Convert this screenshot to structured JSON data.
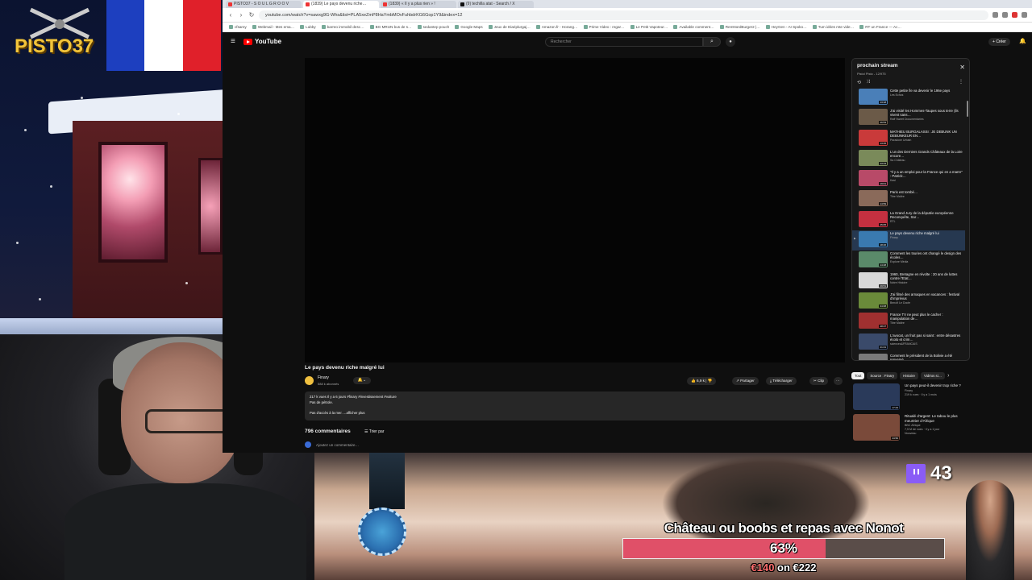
{
  "overlay": {
    "logo_text": "PISTO37",
    "flag_colors": [
      "#1d3fbf",
      "#ffffff",
      "#e0202a"
    ],
    "viewers": "43",
    "goal": {
      "title": "Château ou boobs et repas avec Nonot",
      "percent_label": "63%",
      "percent_value": 0.63,
      "current": "€140",
      "connector": " on ",
      "target": "€222",
      "fill_color": "#e05068"
    }
  },
  "browser": {
    "tabs": [
      {
        "label": "PISTO37 - S O U L G R O O V"
      },
      {
        "label": "(1839) Le pays devenu riche…"
      },
      {
        "label": "(1839) « Il y a plus rien » !"
      },
      {
        "label": "(9) techilla atat - Search / X"
      }
    ],
    "url": "youtube.com/watch?v=sawxg9G-Whs&list=PLA5xeZmP8HaYmbMOvFuhbdrKG6Gop1Y9&index=12",
    "bookmarks": [
      "cfsarey",
      "Webmail - Mes ema…",
      "Lubby",
      "barreo immobil desc…",
      "BG MRUN bus de s…",
      "sedantep pouch",
      "Google Maps",
      "Jeux de Diariplurgaj…",
      "Amazon.fr - Horang…",
      "Prime Video : regar…",
      "Le Petit Vapoteur…",
      "Available comment…",
      "RemNordBurger2 |…",
      "HeyGen - AI Spoko…",
      "Tum idées mte vide…",
      "RT un France — Ac…"
    ]
  },
  "youtube": {
    "logo": "YouTube",
    "search_placeholder": "Rechercher",
    "create_label": "Créer",
    "video": {
      "title": "Le pays devenu riche malgré lui",
      "channel": "Finary",
      "subs": "588 k abonnés",
      "likes": "6,9 k",
      "actions": [
        "Partager",
        "Télécharger",
        "Clip"
      ],
      "desc_meta": "217 k vues  Il y a 6 jours  #finary #investissement #voiture",
      "desc_l2": "Pas de pétrole.",
      "desc_l3": "Pas d'accès à la mer. ...afficher plus",
      "comments_count": "796 commentaires",
      "sort_label": "Trier par",
      "add_comment": "Ajoutez un commentaire…"
    },
    "playlist": {
      "title": "prochain stream",
      "subtitle": "Pistol Pisto - 12/975",
      "items": [
        {
          "title": "Cette petite île va devenir le 196e pays",
          "channel": "Les Echos",
          "duration": "13:18",
          "color": "#4a7fb8"
        },
        {
          "title": "J'ai visité les Hommes-Taupes sous terre (ils vivent sans…",
          "channel": "Raff Sweet Documentaries",
          "duration": "26:53",
          "color": "#6b5a48"
        },
        {
          "title": "MATHIEU BURGALASSI : JE DEBUNK UN DEBUNKEUR EN…",
          "channel": "Paradoxe Urbain",
          "duration": "13:25",
          "color": "#c93a3a"
        },
        {
          "title": "L'un des Derniers Grands Châteaux de la Loire encore…",
          "channel": "Sa Château",
          "duration": "43:23",
          "color": "#7a8a5a"
        },
        {
          "title": "\"Il y a un emploi pour la France qui en a marre\" : Patrick…",
          "channel": "Kasl",
          "duration": "19:01",
          "color": "#b84a68"
        },
        {
          "title": "Paris est tombé…",
          "channel": "Titre Maître",
          "duration": "14:59",
          "color": "#8a6a5a"
        },
        {
          "title": "La Grand Jury de la députée européenne Reconquête, Sar…",
          "channel": "RTL",
          "duration": "45:05",
          "color": "#c43040"
        },
        {
          "title": "Le pays devenu riche malgré lui",
          "channel": "Finary",
          "duration": "18:26",
          "color": "#3a7ab0",
          "current": true
        },
        {
          "title": "Comment les tsuries ont changé le design des écoles…",
          "channel": "Explore Média",
          "duration": "14:48",
          "color": "#5a8a6a"
        },
        {
          "title": "1960, Bretagne en révolte : 20 ans de luttes contre l'Etat…",
          "channel": "Notre Histoire",
          "duration": "49:51",
          "color": "#d8d8d8"
        },
        {
          "title": "J'ai filmé des arnaques en vacances : festival d'imprévus",
          "channel": "Benoît Le Docte",
          "duration": "34:08",
          "color": "#6a8a3a"
        },
        {
          "title": "France TV ne peut plus le cacher : manipulation de…",
          "channel": "Titre Maître",
          "duration": "28:27",
          "color": "#a03030"
        },
        {
          "title": "L'avocat, un fruit pas si saint : entre désastres écolo et crim…",
          "channel": "sciences&FRANCAIS",
          "duration": "21:21",
          "color": "#3a4a6a"
        },
        {
          "title": "Comment le président de la Bolivie a été renversé…",
          "channel": "",
          "duration": "",
          "color": "#7a7a7a"
        }
      ]
    },
    "chips": [
      {
        "label": "Tout",
        "selected": true
      },
      {
        "label": "Source : Finary",
        "selected": false
      },
      {
        "label": "Histoire",
        "selected": false
      },
      {
        "label": "Vidéos si…",
        "selected": false
      }
    ],
    "recs": [
      {
        "title": "Un pays peut-il devenir trop riche ?",
        "channel": "Finary",
        "meta": "219 k vues · Il y a 1 mois",
        "duration": "17:44",
        "color": "#2a3a5a"
      },
      {
        "title": "Ritualé d'argent: Le tabou le plus meurtrier d'Afrique",
        "channel": "BBC Afrique",
        "meta": "7,5 M de vues · Il y a 1 jour",
        "duration": "44:50",
        "color": "#7a4a3a",
        "badge": "Nouveau"
      }
    ]
  }
}
